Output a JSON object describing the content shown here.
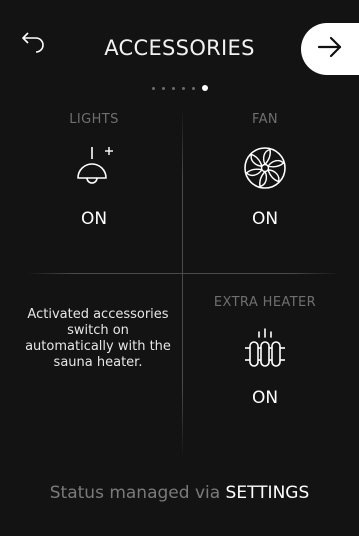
{
  "header": {
    "title": "ACCESSORIES",
    "back_icon": "back-arrow-icon",
    "next_icon": "arrow-right-icon"
  },
  "pager": {
    "total": 6,
    "active_index": 5
  },
  "tiles": {
    "lights": {
      "label": "LIGHTS",
      "state": "ON",
      "icon": "lamp-icon"
    },
    "fan": {
      "label": "FAN",
      "state": "ON",
      "icon": "fan-icon"
    },
    "extra_heater": {
      "label": "EXTRA HEATER",
      "state": "ON",
      "icon": "heater-icon"
    }
  },
  "info_text": "Activated accessories switch on automatically with the sauna heater.",
  "footer": {
    "text": "Status managed via",
    "link": "SETTINGS"
  },
  "colors": {
    "background": "#131313",
    "text_primary": "#ffffff",
    "text_muted": "#6f6f6f",
    "divider": "#4a4a4a"
  }
}
